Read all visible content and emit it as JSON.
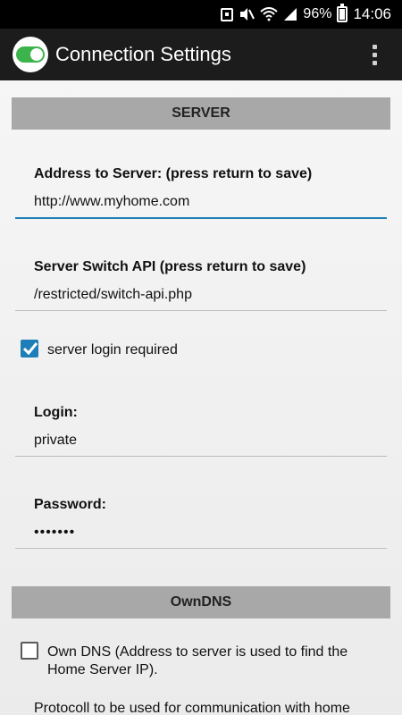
{
  "status_bar": {
    "battery": "96%",
    "time": "14:06"
  },
  "app_bar": {
    "title": "Connection Settings",
    "logo_icon": "toggle-switch-icon",
    "menu_icon": "overflow-menu-icon"
  },
  "sections": {
    "server": "SERVER",
    "owndns": "OwnDNS"
  },
  "fields": {
    "address": {
      "label": "Address to Server: (press return to save)",
      "value": "http://www.myhome.com"
    },
    "api": {
      "label": "Server Switch API (press return to save)",
      "value": "/restricted/switch-api.php"
    },
    "login": {
      "label": "Login:",
      "value": "private"
    },
    "password": {
      "label": "Password:",
      "value": "•••••••"
    }
  },
  "checkboxes": {
    "server_login": {
      "label": "server login required",
      "checked": true
    },
    "own_dns": {
      "label_line1": "Own DNS (Address to server is used to find the",
      "label_line2": "Home Server IP).",
      "checked": false
    }
  },
  "protocol_text": "Protocoll to be used for communication with home",
  "colors": {
    "accent": "#1e7fb8",
    "section_bg": "#a8a8a8",
    "app_bar": "#1c1c1c",
    "logo_green": "#3cb44b"
  }
}
